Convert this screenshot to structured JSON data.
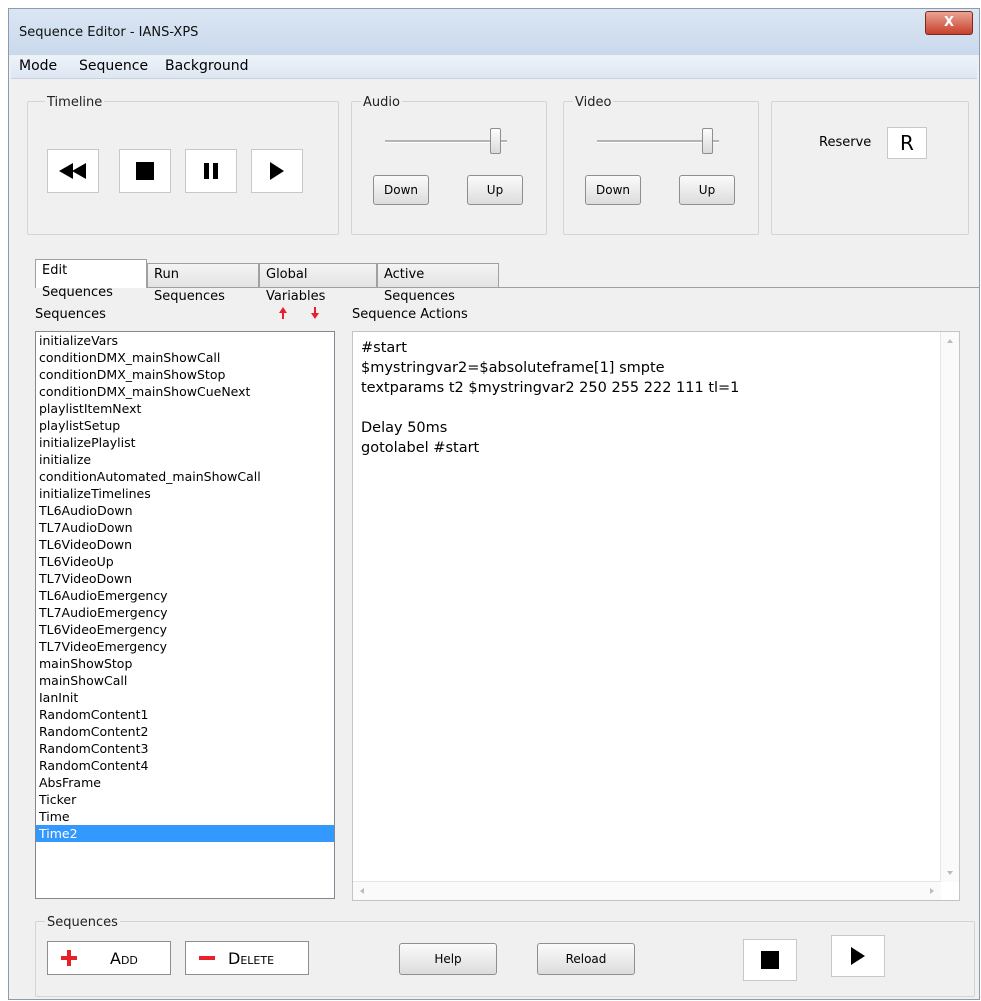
{
  "window": {
    "title": "Sequence Editor - IANS-XPS",
    "close_label": "X"
  },
  "menu": [
    "Mode",
    "Sequence",
    "Background"
  ],
  "timeline": {
    "label": "Timeline"
  },
  "audio": {
    "label": "Audio",
    "down": "Down",
    "up": "Up",
    "level": 0.95
  },
  "video": {
    "label": "Video",
    "down": "Down",
    "up": "Up",
    "level": 0.95
  },
  "reserve": {
    "label": "Reserve",
    "button": "R"
  },
  "tabs": [
    "Edit Sequences",
    "Run Sequences",
    "Global Variables",
    "Active Sequences"
  ],
  "sequences": {
    "label": "Sequences",
    "items": [
      "initializeVars",
      "conditionDMX_mainShowCall",
      "conditionDMX_mainShowStop",
      "conditionDMX_mainShowCueNext",
      "playlistItemNext",
      "playlistSetup",
      "initializePlaylist",
      "initialize",
      "conditionAutomated_mainShowCall",
      "initializeTimelines",
      "TL6AudioDown",
      "TL7AudioDown",
      "TL6VideoDown",
      "TL6VideoUp",
      "TL7VideoDown",
      "TL6AudioEmergency",
      "TL7AudioEmergency",
      "TL6VideoEmergency",
      "TL7VideoEmergency",
      "mainShowStop",
      "mainShowCall",
      "IanInit",
      "RandomContent1",
      "RandomContent2",
      "RandomContent3",
      "RandomContent4",
      "AbsFrame",
      "Ticker",
      "Time",
      "Time2"
    ],
    "selected": "Time2"
  },
  "actions": {
    "label": "Sequence Actions",
    "lines": [
      "#start",
      "$mystringvar2=$absoluteframe[1] smpte",
      "textparams t2 $mystringvar2 250 255 222 111 tl=1",
      "",
      "Delay 50ms",
      "gotolabel #start"
    ]
  },
  "bottom": {
    "label": "Sequences",
    "add": "Add",
    "delete": "Delete",
    "help": "Help",
    "reload": "Reload"
  },
  "colors": {
    "accent_red": "#e8202a",
    "selection": "#3399ff"
  }
}
